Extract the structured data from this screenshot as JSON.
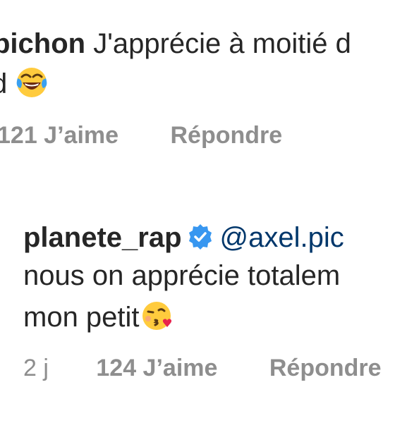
{
  "comments": [
    {
      "username_fragment": "pichon",
      "text_line1": " J'apprécie à moitié d",
      "text_line2_fragment": "d",
      "emoji": "face-with-tears-of-joy-icon",
      "likes": "121 J’aime",
      "reply": "Répondre"
    },
    {
      "username": "planete_rap",
      "verified": true,
      "mention": "@axel.pic",
      "text_line2": "nous on apprécie totalem",
      "text_line3": "mon petit",
      "emoji": "face-blowing-a-kiss-icon",
      "time": "2 j",
      "likes": "124 J’aime",
      "reply": "Répondre"
    }
  ],
  "colors": {
    "primary_text": "#262626",
    "secondary_text": "#8e8e8e",
    "mention": "#00376b",
    "verified_badge": "#3897f0"
  }
}
